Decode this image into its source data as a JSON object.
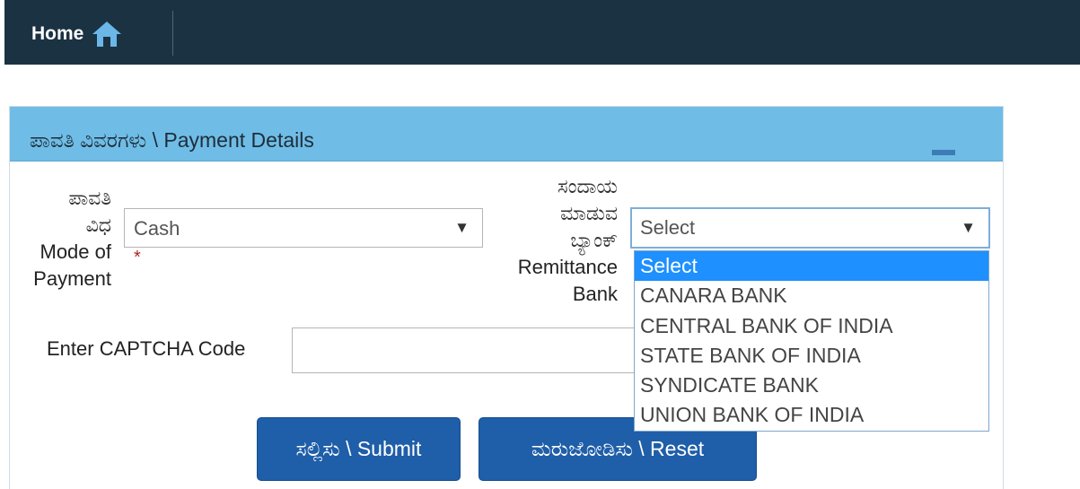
{
  "nav": {
    "home_label": "Home",
    "home_icon": "home-icon"
  },
  "panel": {
    "title": "ಪಾವತಿ ವಿವರಗಳು \\ Payment Details",
    "collapse_icon": "minus-icon"
  },
  "mode_of_payment": {
    "label_kn_1": "ಪಾವತಿ",
    "label_kn_2": "ವಿಧ",
    "label_en_1": "Mode of",
    "label_en_2": "Payment",
    "value": "Cash",
    "required_mark": "*"
  },
  "remittance_bank": {
    "label_kn_1": "ಸಂದಾಯ",
    "label_kn_2": "ಮಾಡುವ",
    "label_kn_3": "ಬ್ಯಾಂಕ್",
    "label_en_1": "Remittance",
    "label_en_2": "Bank",
    "value": "Select",
    "options": [
      "Select",
      "CANARA BANK",
      "CENTRAL BANK OF INDIA",
      "STATE BANK OF INDIA",
      "SYNDICATE BANK",
      "UNION BANK OF INDIA"
    ],
    "highlighted_option": "Select"
  },
  "captcha": {
    "label": "Enter CAPTCHA Code",
    "value": ""
  },
  "buttons": {
    "submit_label": "ಸಲ್ಲಿಸು \\ Submit",
    "reset_label": "ಮರುಜೋಡಿಸು \\ Reset"
  },
  "colors": {
    "topbar": "#1b3242",
    "panel_header": "#6fbde6",
    "button": "#1f5ea8",
    "dropdown_highlight": "#1e90ff"
  }
}
